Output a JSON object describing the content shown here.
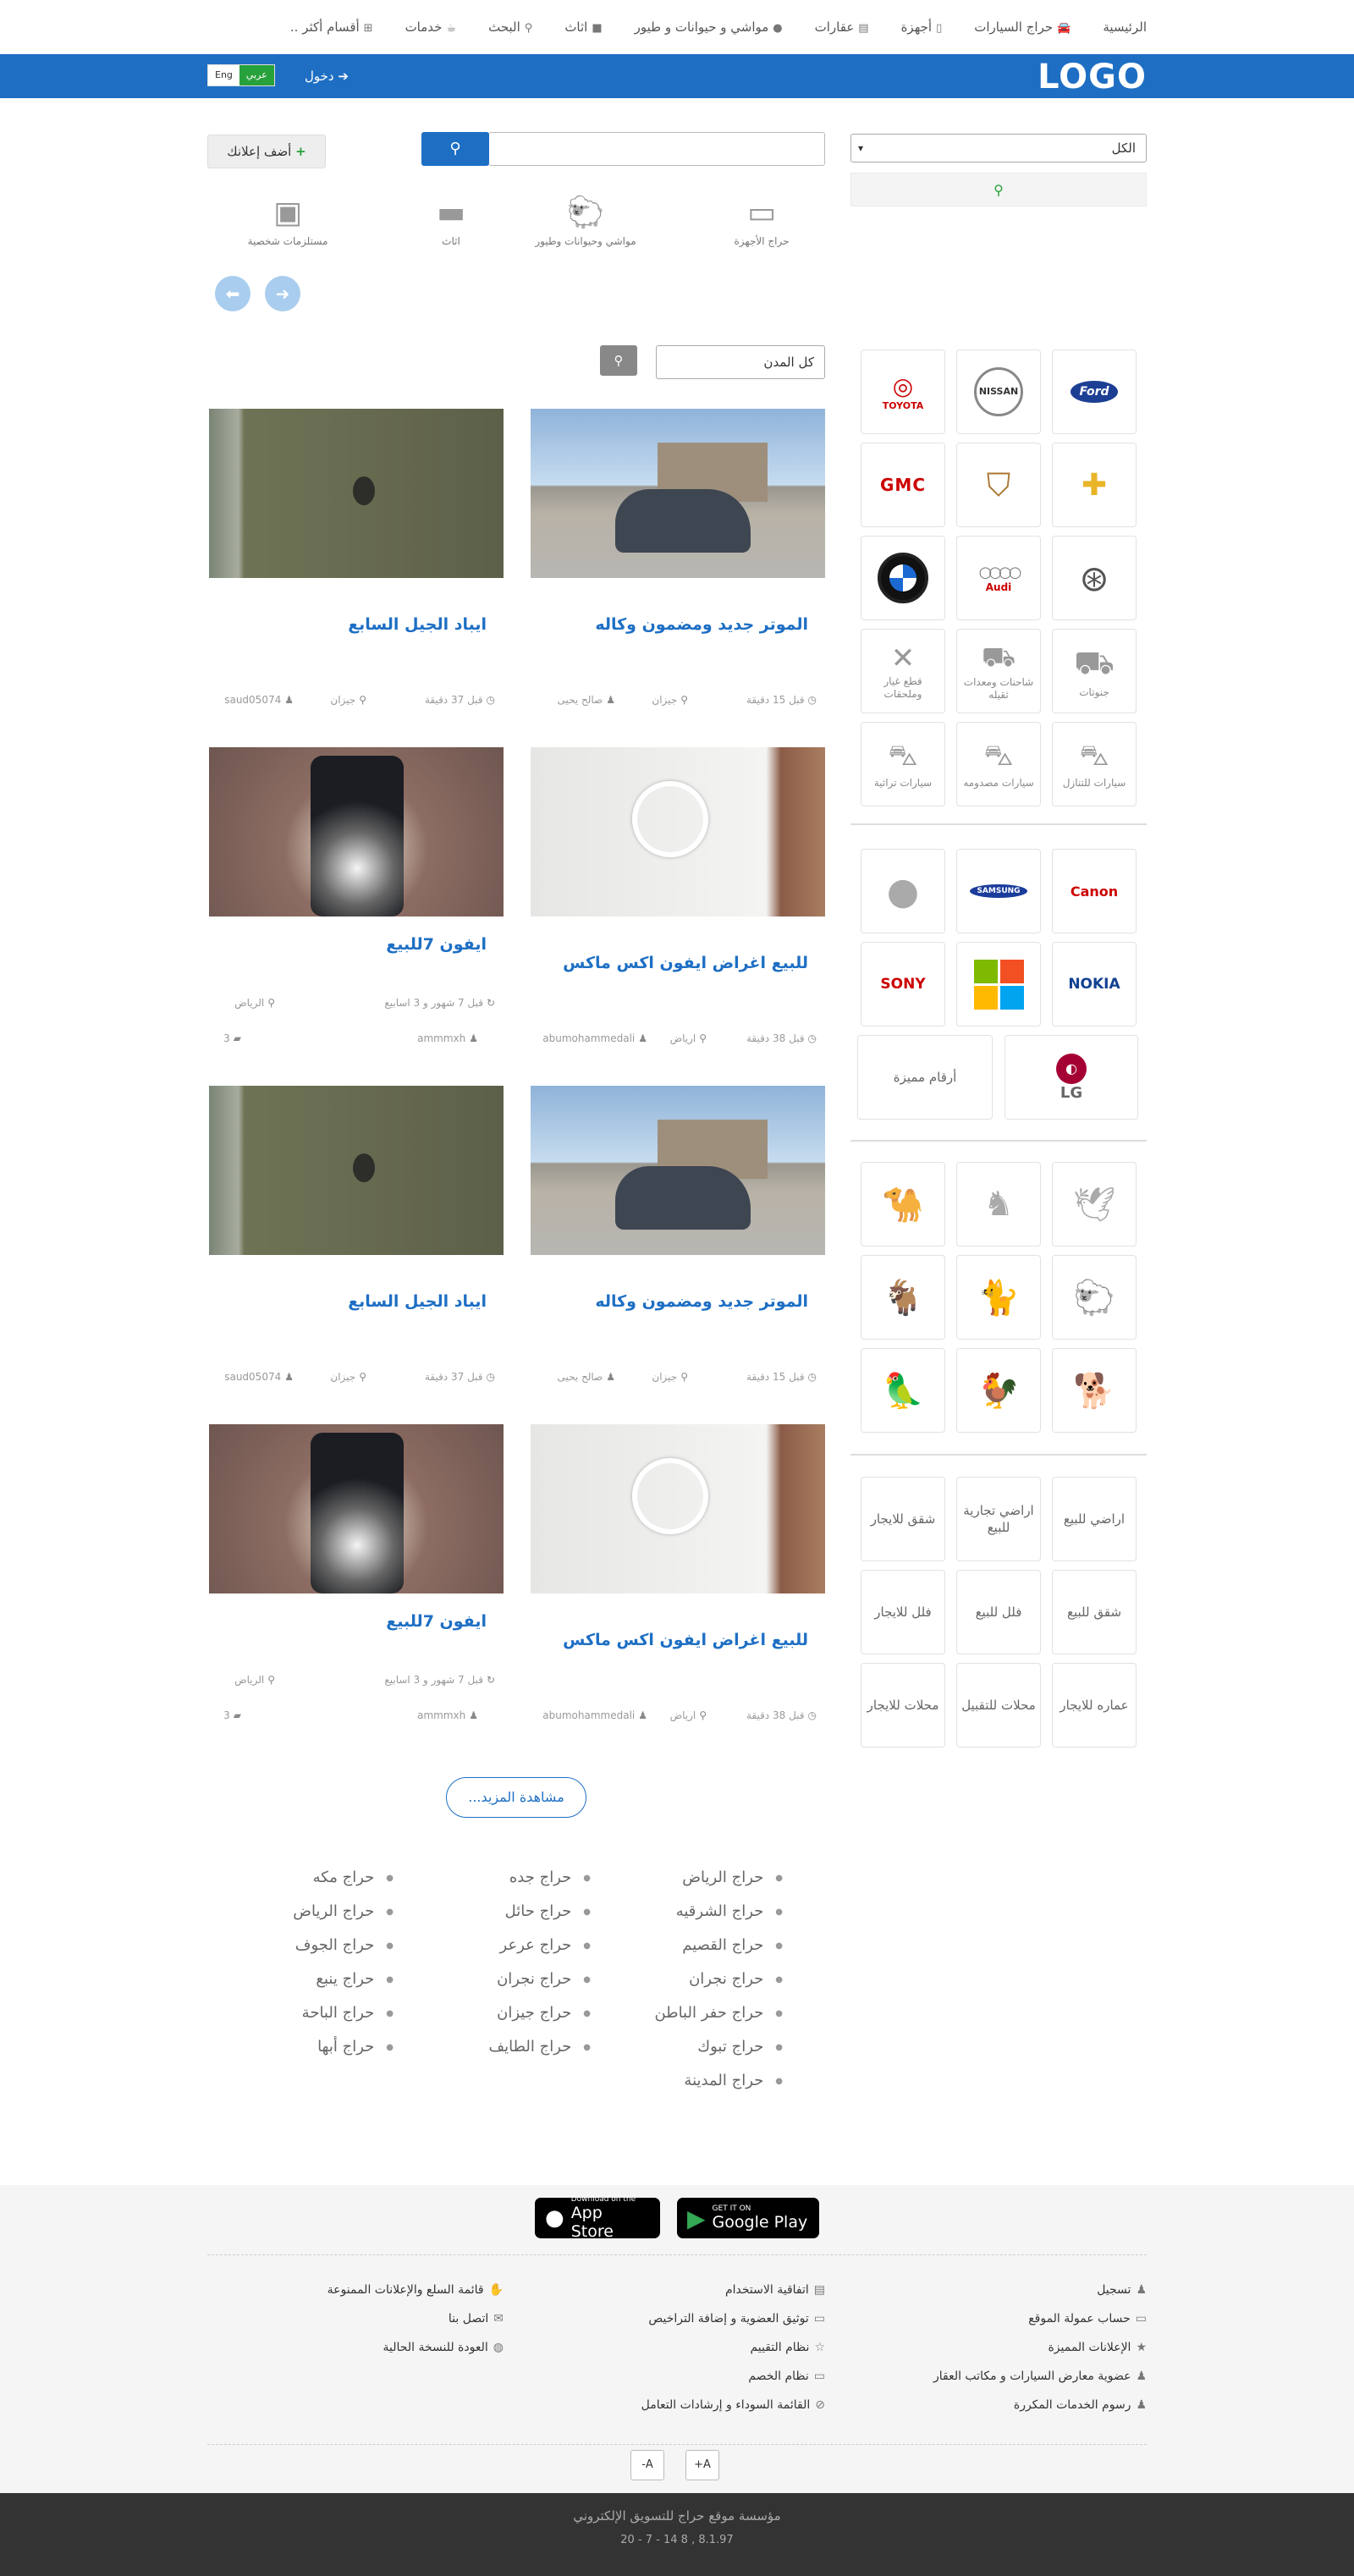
{
  "nav": {
    "items": [
      "الرئيسية",
      "حراج السيارات",
      "أجهزة",
      "عقارات",
      "مواشي و حيوانات و طيور",
      "اثاث",
      "البحث",
      "خدمات",
      "أقسام أكثر .."
    ],
    "icons": [
      "",
      "car-icon",
      "phone-icon",
      "building-icon",
      "comment-icon",
      "truck-icon",
      "search-icon",
      "coffee-icon",
      "sitemap-icon"
    ]
  },
  "header": {
    "logo": "LOGO",
    "login": "دخول",
    "lang_ar": "عربي",
    "lang_en": "Eng"
  },
  "search": {
    "category_select": "الكل",
    "placeholder": "",
    "add_ad": "أضف إعلانك"
  },
  "categories": [
    "حراج الأجهزة",
    "مواشي وحيوانات وطيور",
    "اثاث",
    "مستلزمات شخصية"
  ],
  "city_select": "كل المدن",
  "car_brands": [
    "Ford",
    "NISSAN",
    "TOYOTA",
    "CHEVROLET",
    "CADILLAC",
    "GMC",
    "Mercedes-Benz",
    "Audi",
    "BMW"
  ],
  "car_types": [
    "جنوتات",
    "شاحنات ومعدات ثقيله",
    "قطع غيار وملحقات",
    "سيارات للتنازل",
    "سيارات مصدومه",
    "سيارات تراثية"
  ],
  "device_brands": [
    "Canon",
    "SAMSUNG",
    "Apple",
    "NOKIA",
    "Microsoft",
    "SONY",
    "LG",
    "أرقام مميزة"
  ],
  "animals": [
    "bird-icon",
    "horse-icon",
    "camel-icon",
    "sheep-icon",
    "cat-icon",
    "goat-icon",
    "dog-icon",
    "rooster-icon",
    "parrot-icon"
  ],
  "realestate": [
    "اراضي للبيع",
    "اراضي تجارية للبيع",
    "شقق للايجار",
    "شقق للبيع",
    "فلل للبيع",
    "فلل للايجار",
    "عماره للايجار",
    "محلات للتقبيل",
    "محلات للايجار"
  ],
  "ads": [
    {
      "title": "الموتر جديد ومضمون وكاله",
      "time": "قبل 15 دقيقة",
      "city": "جيزان",
      "user": "صالح يحيى",
      "comments": ""
    },
    {
      "title": "ايباد الجيل السابع",
      "time": "قبل 37 دقيقة",
      "city": "جيزان",
      "user": "saud05074",
      "comments": ""
    },
    {
      "title": "للبيع اغراض ايفون اكس ماكس",
      "time": "قبل 38 دقيقة",
      "city": "ارياض",
      "user": "abumohammedali",
      "comments": ""
    },
    {
      "title": "ايفون 7للبيع",
      "time": "قبل 7 شهور و 3 اسابيع",
      "city": "الرياض",
      "user": "ammmxh",
      "comments": "3"
    },
    {
      "title": "الموتر جديد ومضمون وكاله",
      "time": "قبل 15 دقيقة",
      "city": "جيزان",
      "user": "صالح يحيى",
      "comments": ""
    },
    {
      "title": "ايباد الجيل السابع",
      "time": "قبل 37 دقيقة",
      "city": "جيزان",
      "user": "saud05074",
      "comments": ""
    },
    {
      "title": "للبيع اغراض ايفون اكس ماكس",
      "time": "قبل 38 دقيقة",
      "city": "ارياض",
      "user": "abumohammedali",
      "comments": ""
    },
    {
      "title": "ايفون 7للبيع",
      "time": "قبل 7 شهور و 3 اسابيع",
      "city": "الرياض",
      "user": "ammmxh",
      "comments": "3"
    }
  ],
  "more_button": "مشاهدة المزيد...",
  "cities": {
    "col1": [
      "حراج الرياض",
      "حراج الشرقيه",
      "حراج القصيم",
      "حراج نجران",
      "حراج حفر الباطن",
      "حراج تبوك",
      "حراج المدينة"
    ],
    "col2": [
      "حراج جده",
      "حراج حائل",
      "حراج عرعر",
      "حراج نجران",
      "حراج جيزان",
      "حراج الطايف"
    ],
    "col3": [
      "حراج مكه",
      "حراج الرياض",
      "حراج الجوف",
      "حراج ينبع",
      "حراج الباحة",
      "حراج أبها"
    ]
  },
  "stores": {
    "google_small": "GET IT ON",
    "google_big": "Google Play",
    "apple_small": "Download on the",
    "apple_big": "App Store"
  },
  "footer_links": {
    "col1": [
      "تسجيل",
      "حساب عمولة الموقع",
      "الإعلانات المميزة",
      "عضوية معارض السيارات و مكاتب العقار",
      "رسوم الخدمات المكررة"
    ],
    "col2": [
      "اتفاقية الاستخدام",
      "توثيق العضوية و إضافة التراخيص",
      "نظام التقييم",
      "نظام الخصم",
      "القائمة السوداء و إرشادات التعامل"
    ],
    "col3": [
      "قائمة السلع والإعلانات الممنوعة",
      "اتصل بنا",
      "العودة للنسخة الحالية"
    ]
  },
  "font_controls": {
    "minus": "A-",
    "plus": "A+"
  },
  "bottom": {
    "company": "مؤسسة موقع حراج للتسويق الإلكتروني",
    "version": "20 - 7 - 14 8 , 8.1.97"
  }
}
